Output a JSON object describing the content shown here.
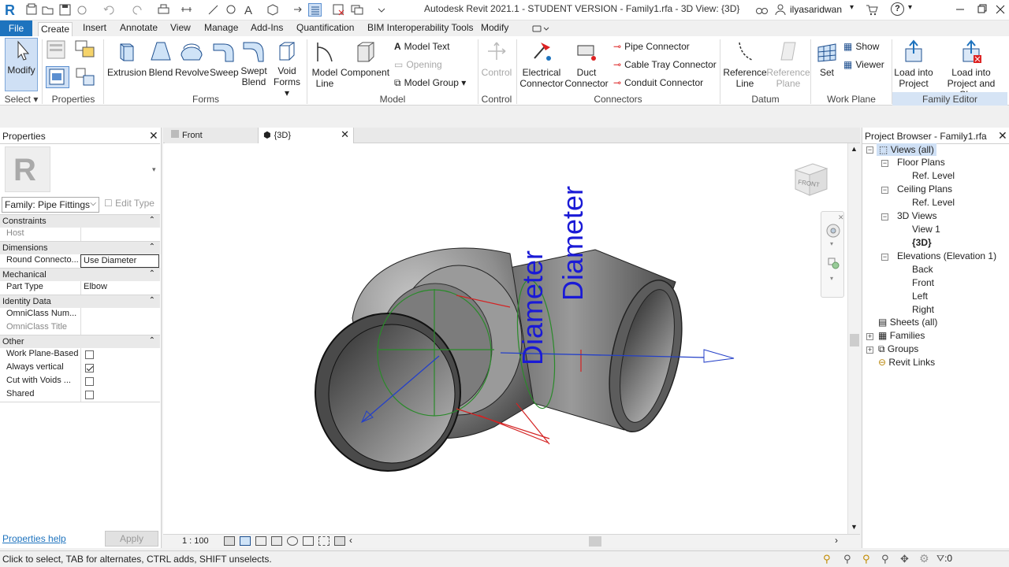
{
  "window": {
    "title": "Autodesk Revit 2021.1 - STUDENT VERSION - Family1.rfa - 3D View: {3D}",
    "user": "ilyasaridwan",
    "help": "?"
  },
  "tabs": [
    "File",
    "Create",
    "Insert",
    "Annotate",
    "View",
    "Manage",
    "Add-Ins",
    "Quantification",
    "BIM Interoperability Tools",
    "Modify"
  ],
  "ribbon": {
    "select": {
      "modify": "Modify",
      "panel": "Select"
    },
    "properties": {
      "panel": "Properties"
    },
    "forms": {
      "items": [
        "Extrusion",
        "Blend",
        "Revolve",
        "Sweep",
        "Swept\nBlend",
        "Void\nForms"
      ],
      "extrusion": "Extrusion",
      "blend": "Blend",
      "revolve": "Revolve",
      "sweep": "Sweep",
      "swept1": "Swept",
      "swept2": "Blend",
      "void1": "Void",
      "void2": "Forms",
      "panel": "Forms"
    },
    "model": {
      "line1": "Model",
      "line2": "Line",
      "component": "Component",
      "text": "Model  Text",
      "opening": "Opening",
      "group": "Model  Group",
      "panel": "Model"
    },
    "control": {
      "label": "Control",
      "panel": "Control"
    },
    "connectors": {
      "elec1": "Electrical",
      "elec2": "Connector",
      "duct1": "Duct",
      "duct2": "Connector",
      "pipe": "Pipe  Connector",
      "cable": "Cable Tray  Connector",
      "conduit": "Conduit  Connector",
      "panel": "Connectors"
    },
    "datum": {
      "ref1": "Reference",
      "ref2": "Line",
      "plane1": "Reference",
      "plane2": "Plane",
      "panel": "Datum"
    },
    "workplane": {
      "set": "Set",
      "show": "Show",
      "viewer": "Viewer",
      "panel": "Work Plane"
    },
    "family_editor": {
      "load1": "Load into",
      "load2": "Project",
      "loadclose1": "Load into",
      "loadclose2": "Project and Close",
      "panel": "Family Editor"
    }
  },
  "properties": {
    "header": "Properties",
    "family_type": "Family: Pipe Fittings",
    "edit_type": "Edit Type",
    "groups": {
      "constraints": "Constraints",
      "dimensions": "Dimensions",
      "mechanical": "Mechanical",
      "identity": "Identity Data",
      "other": "Other"
    },
    "rows": {
      "host": {
        "k": "Host",
        "v": ""
      },
      "round_conn": {
        "k": "Round Connecto...",
        "v": "Use Diameter"
      },
      "part_type": {
        "k": "Part Type",
        "v": "Elbow"
      },
      "omni_num": {
        "k": "OmniClass Num...",
        "v": ""
      },
      "omni_title": {
        "k": "OmniClass Title",
        "v": ""
      },
      "wp_based": {
        "k": "Work Plane-Based",
        "checked": false
      },
      "always_vertical": {
        "k": "Always vertical",
        "checked": true
      },
      "cut_voids": {
        "k": "Cut with Voids ...",
        "checked": false
      },
      "shared": {
        "k": "Shared",
        "checked": false
      }
    },
    "help_link": "Properties help",
    "apply": "Apply"
  },
  "viewport": {
    "tabs": [
      {
        "label": "Front"
      },
      {
        "label": "{3D}"
      }
    ],
    "scale": "1 : 100",
    "viewcube_label": "FRONT",
    "labels": [
      "Diameter",
      "Diameter"
    ]
  },
  "browser": {
    "header": "Project Browser - Family1.rfa",
    "items": {
      "views_all": "Views (all)",
      "floor_plans": "Floor Plans",
      "fp_ref": "Ref. Level",
      "ceiling_plans": "Ceiling Plans",
      "cp_ref": "Ref. Level",
      "views3d": "3D Views",
      "view1": "View 1",
      "v3d": "{3D}",
      "elevations": "Elevations (Elevation 1)",
      "back": "Back",
      "front": "Front",
      "left": "Left",
      "right": "Right",
      "sheets": "Sheets (all)",
      "families": "Families",
      "groups": "Groups",
      "links": "Revit Links"
    }
  },
  "status": {
    "message": "Click to select, TAB for alternates, CTRL adds, SHIFT unselects.",
    "filter_count": ":0"
  },
  "colors": {
    "accent": "#1e73be",
    "label_blue": "#1a1ad6",
    "family_editor_bg": "#d6e4f5"
  }
}
